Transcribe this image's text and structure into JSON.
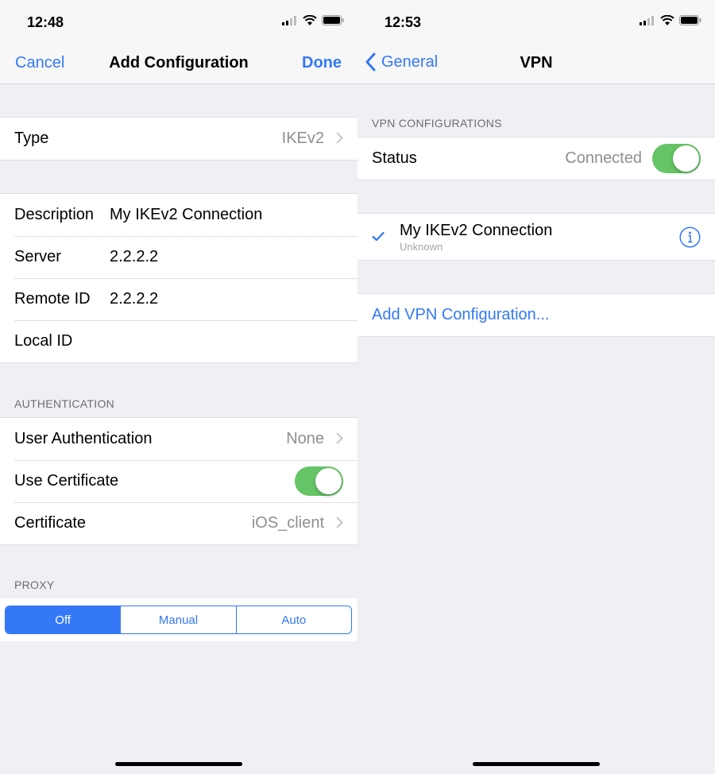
{
  "left": {
    "status_bar": {
      "time": "12:48"
    },
    "nav": {
      "cancel_label": "Cancel",
      "title": "Add Configuration",
      "done_label": "Done"
    },
    "type_row": {
      "label": "Type",
      "value": "IKEv2"
    },
    "fields": [
      {
        "label": "Description",
        "value": "My IKEv2 Connection"
      },
      {
        "label": "Server",
        "value": "2.2.2.2"
      },
      {
        "label": "Remote ID",
        "value": "2.2.2.2"
      },
      {
        "label": "Local ID",
        "value": ""
      }
    ],
    "authentication": {
      "header": "AUTHENTICATION",
      "user_auth": {
        "label": "User Authentication",
        "value": "None"
      },
      "use_certificate": {
        "label": "Use Certificate",
        "on": true
      },
      "certificate": {
        "label": "Certificate",
        "value": "iOS_client"
      }
    },
    "proxy": {
      "header": "PROXY",
      "options": [
        "Off",
        "Manual",
        "Auto"
      ],
      "selected": "Off"
    }
  },
  "right": {
    "status_bar": {
      "time": "12:53"
    },
    "nav": {
      "back_label": "General",
      "title": "VPN"
    },
    "configurations": {
      "header": "VPN CONFIGURATIONS",
      "status": {
        "label": "Status",
        "value": "Connected",
        "on": true
      }
    },
    "connection": {
      "name": "My IKEv2 Connection",
      "subtitle": "Unknown",
      "selected": true
    },
    "add_label": "Add VPN Configuration..."
  },
  "colors": {
    "accent": "#3478f6",
    "toggle_on": "#65c466",
    "background": "#efeff4"
  }
}
